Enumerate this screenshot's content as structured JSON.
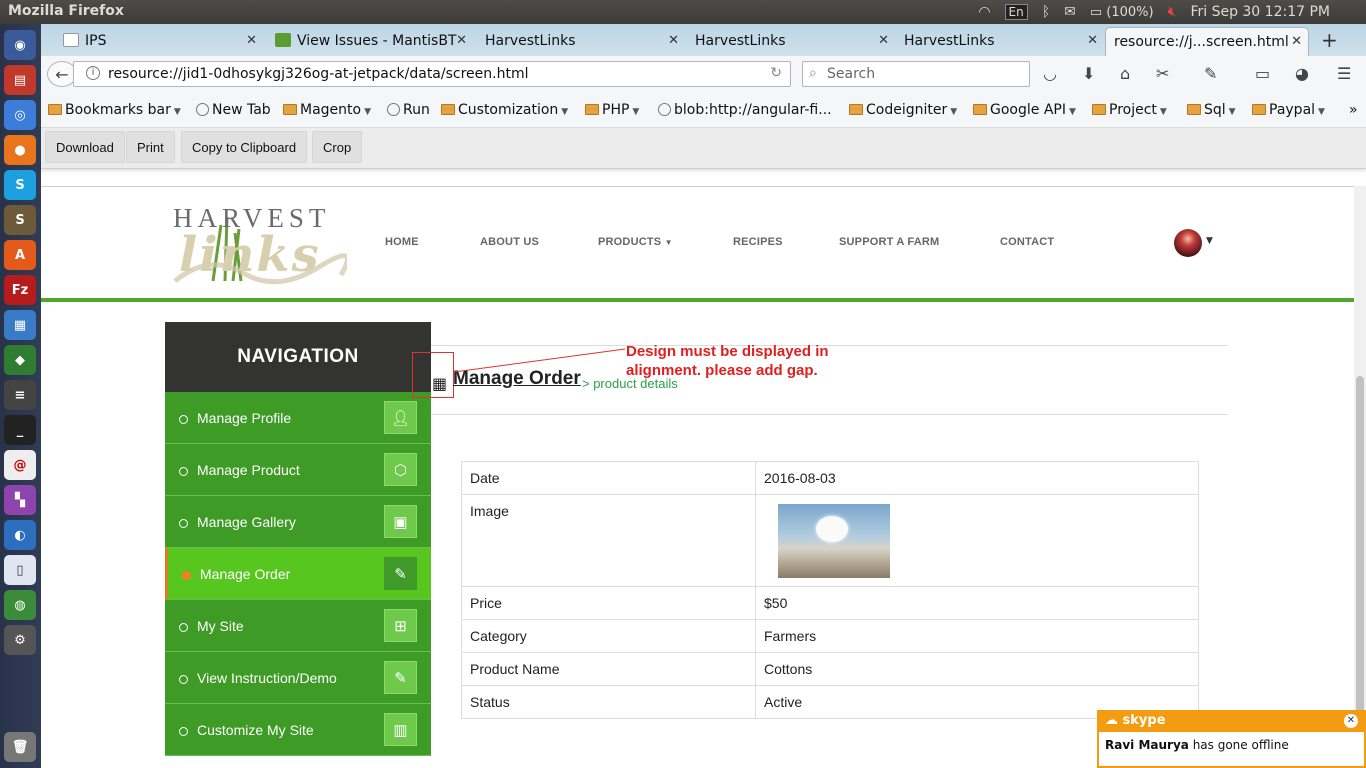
{
  "os": {
    "window_title": "Mozilla Firefox",
    "input_lang": "En",
    "battery": "(100%)",
    "clock": "Fri Sep 30 12:17 PM"
  },
  "browser": {
    "tabs": [
      {
        "label": "IPS"
      },
      {
        "label": "View Issues - MantisBT"
      },
      {
        "label": "HarvestLinks"
      },
      {
        "label": "HarvestLinks"
      },
      {
        "label": "HarvestLinks"
      },
      {
        "label": "resource://j...screen.html"
      }
    ],
    "url": "resource://jid1-0dhosykgj326og-at-jetpack/data/screen.html",
    "search_placeholder": "Search",
    "bookmarks": [
      {
        "label": "Bookmarks bar"
      },
      {
        "label": "New Tab"
      },
      {
        "label": "Magento"
      },
      {
        "label": "Run"
      },
      {
        "label": "Customization"
      },
      {
        "label": "PHP"
      },
      {
        "label": "blob:http://angular-fi..."
      },
      {
        "label": "Codeigniter"
      },
      {
        "label": "Google API"
      },
      {
        "label": "Project"
      },
      {
        "label": "Sql"
      },
      {
        "label": "Paypal"
      }
    ]
  },
  "screenshot_tool": {
    "download": "Download",
    "print": "Print",
    "copy": "Copy to Clipboard",
    "crop": "Crop"
  },
  "site": {
    "logo_top": "HARVEST",
    "logo_bottom": "links",
    "menu": [
      "HOME",
      "ABOUT US",
      "PRODUCTS",
      "RECIPES",
      "SUPPORT A FARM",
      "CONTACT"
    ]
  },
  "sidenav": {
    "title": "NAVIGATION",
    "items": [
      {
        "label": "Manage Profile",
        "icon": "user-icon"
      },
      {
        "label": "Manage Product",
        "icon": "box-icon"
      },
      {
        "label": "Manage Gallery",
        "icon": "gallery-icon"
      },
      {
        "label": "Manage Order",
        "icon": "edit-icon",
        "active": true
      },
      {
        "label": "My Site",
        "icon": "site-icon"
      },
      {
        "label": "View Instruction/Demo",
        "icon": "edit-icon"
      },
      {
        "label": "Customize My Site",
        "icon": "customize-icon"
      }
    ]
  },
  "content": {
    "title": "Manage Order",
    "breadcrumb": "> product details",
    "annotation": "Design must be displayed in alignment. please add gap.",
    "details": [
      {
        "key": "Date",
        "value": "2016-08-03"
      },
      {
        "key": "Image",
        "value": ""
      },
      {
        "key": "Price",
        "value": "$50"
      },
      {
        "key": "Category",
        "value": "Farmers"
      },
      {
        "key": "Product Name",
        "value": "Cottons"
      },
      {
        "key": "Status",
        "value": "Active"
      }
    ]
  },
  "notification": {
    "app": "skype",
    "user": "Ravi Maurya",
    "message": " has gone offline"
  },
  "colors": {
    "brand_green": "#3e9b26",
    "active_green": "#57c61e",
    "annotation_red": "#e21f1f",
    "skype_orange": "#f39c12"
  }
}
